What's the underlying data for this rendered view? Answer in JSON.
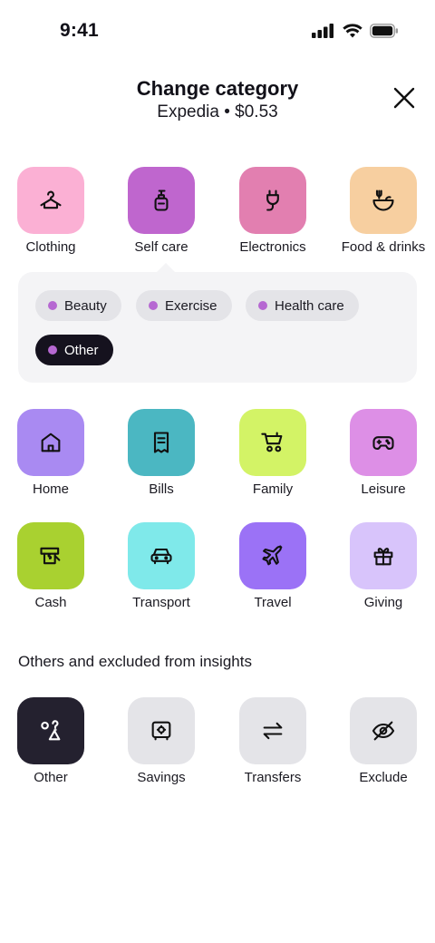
{
  "status": {
    "time": "9:41"
  },
  "header": {
    "title": "Change category",
    "subtitle": "Expedia • $0.53"
  },
  "categories_top": [
    {
      "label": "Clothing",
      "icon": "hanger-icon",
      "color": "#fbb0d4"
    },
    {
      "label": "Self care",
      "icon": "soap-bottle-icon",
      "color": "#bf66ce"
    },
    {
      "label": "Electronics",
      "icon": "plug-icon",
      "color": "#e27fb0"
    },
    {
      "label": "Food & drinks",
      "icon": "bowl-icon",
      "color": "#f7cfa0"
    }
  ],
  "subcategories": [
    {
      "label": "Beauty",
      "selected": false
    },
    {
      "label": "Exercise",
      "selected": false
    },
    {
      "label": "Health care",
      "selected": false
    },
    {
      "label": "Other",
      "selected": true
    }
  ],
  "categories_mid": [
    {
      "label": "Home",
      "icon": "house-icon",
      "color": "#a98af2"
    },
    {
      "label": "Bills",
      "icon": "receipt-icon",
      "color": "#4bb7c2"
    },
    {
      "label": "Family",
      "icon": "stroller-icon",
      "color": "#d3f366"
    },
    {
      "label": "Leisure",
      "icon": "gamepad-icon",
      "color": "#dd8fe6"
    },
    {
      "label": "Cash",
      "icon": "cash-icon",
      "color": "#a9d130"
    },
    {
      "label": "Transport",
      "icon": "car-icon",
      "color": "#7fe9ea"
    },
    {
      "label": "Travel",
      "icon": "plane-icon",
      "color": "#9b72f6"
    },
    {
      "label": "Giving",
      "icon": "gift-icon",
      "color": "#d8c4fb"
    }
  ],
  "section_title": "Others and excluded from insights",
  "categories_other": [
    {
      "label": "Other",
      "icon": "shapes-icon",
      "color": "#24212f"
    },
    {
      "label": "Savings",
      "icon": "safe-icon",
      "color": "#e4e4e8"
    },
    {
      "label": "Transfers",
      "icon": "arrows-swap-icon",
      "color": "#e4e4e8"
    },
    {
      "label": "Exclude",
      "icon": "eye-off-icon",
      "color": "#e4e4e8"
    }
  ]
}
